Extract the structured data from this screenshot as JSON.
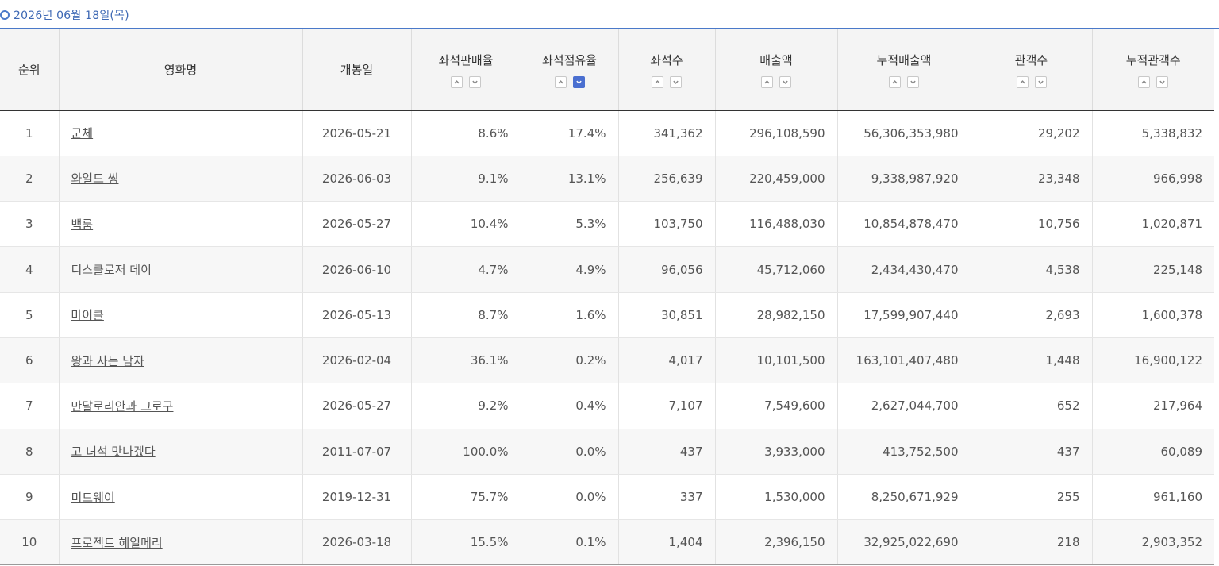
{
  "date_label": "2026년 06월 18일(목)",
  "colors": {
    "accent": "#4a79c9",
    "sort_active": "#4a6fd0",
    "header_bg": "#f4f4f4",
    "row_alt_bg": "#f7f7f7"
  },
  "columns": {
    "rank": "순위",
    "title": "영화명",
    "release": "개봉일",
    "sales_rate": "좌석판매율",
    "share_rate": "좌석점유율",
    "seats": "좌석수",
    "revenue": "매출액",
    "cum_revenue": "누적매출액",
    "audience": "관객수",
    "cum_audience": "누적관객수"
  },
  "sort_icons": {
    "up": "chevron-up-icon",
    "down": "chevron-down-icon",
    "active_column": "share_rate",
    "active_direction": "down"
  },
  "rows": [
    {
      "rank": "1",
      "title": "군체",
      "release": "2026-05-21",
      "sales_rate": "8.6%",
      "share_rate": "17.4%",
      "seats": "341,362",
      "revenue": "296,108,590",
      "cum_revenue": "56,306,353,980",
      "audience": "29,202",
      "cum_audience": "5,338,832"
    },
    {
      "rank": "2",
      "title": "와일드 씽",
      "release": "2026-06-03",
      "sales_rate": "9.1%",
      "share_rate": "13.1%",
      "seats": "256,639",
      "revenue": "220,459,000",
      "cum_revenue": "9,338,987,920",
      "audience": "23,348",
      "cum_audience": "966,998"
    },
    {
      "rank": "3",
      "title": "백룸",
      "release": "2026-05-27",
      "sales_rate": "10.4%",
      "share_rate": "5.3%",
      "seats": "103,750",
      "revenue": "116,488,030",
      "cum_revenue": "10,854,878,470",
      "audience": "10,756",
      "cum_audience": "1,020,871"
    },
    {
      "rank": "4",
      "title": "디스클로저 데이",
      "release": "2026-06-10",
      "sales_rate": "4.7%",
      "share_rate": "4.9%",
      "seats": "96,056",
      "revenue": "45,712,060",
      "cum_revenue": "2,434,430,470",
      "audience": "4,538",
      "cum_audience": "225,148"
    },
    {
      "rank": "5",
      "title": "마이클",
      "release": "2026-05-13",
      "sales_rate": "8.7%",
      "share_rate": "1.6%",
      "seats": "30,851",
      "revenue": "28,982,150",
      "cum_revenue": "17,599,907,440",
      "audience": "2,693",
      "cum_audience": "1,600,378"
    },
    {
      "rank": "6",
      "title": "왕과 사는 남자",
      "release": "2026-02-04",
      "sales_rate": "36.1%",
      "share_rate": "0.2%",
      "seats": "4,017",
      "revenue": "10,101,500",
      "cum_revenue": "163,101,407,480",
      "audience": "1,448",
      "cum_audience": "16,900,122"
    },
    {
      "rank": "7",
      "title": "만달로리안과 그로구",
      "release": "2026-05-27",
      "sales_rate": "9.2%",
      "share_rate": "0.4%",
      "seats": "7,107",
      "revenue": "7,549,600",
      "cum_revenue": "2,627,044,700",
      "audience": "652",
      "cum_audience": "217,964"
    },
    {
      "rank": "8",
      "title": "고 녀석 맛나겠다",
      "release": "2011-07-07",
      "sales_rate": "100.0%",
      "share_rate": "0.0%",
      "seats": "437",
      "revenue": "3,933,000",
      "cum_revenue": "413,752,500",
      "audience": "437",
      "cum_audience": "60,089"
    },
    {
      "rank": "9",
      "title": "미드웨이",
      "release": "2019-12-31",
      "sales_rate": "75.7%",
      "share_rate": "0.0%",
      "seats": "337",
      "revenue": "1,530,000",
      "cum_revenue": "8,250,671,929",
      "audience": "255",
      "cum_audience": "961,160"
    },
    {
      "rank": "10",
      "title": "프로젝트 헤일메리",
      "release": "2026-03-18",
      "sales_rate": "15.5%",
      "share_rate": "0.1%",
      "seats": "1,404",
      "revenue": "2,396,150",
      "cum_revenue": "32,925,022,690",
      "audience": "218",
      "cum_audience": "2,903,352"
    }
  ]
}
